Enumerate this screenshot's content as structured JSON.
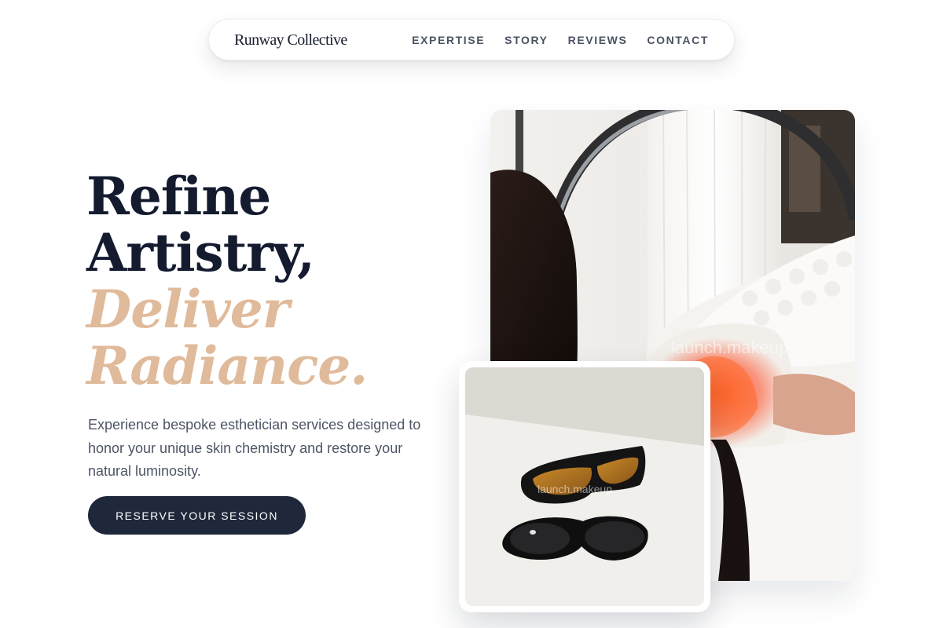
{
  "nav": {
    "brand": "Runway Collective",
    "links": [
      "EXPERTISE",
      "STORY",
      "REVIEWS",
      "CONTACT"
    ]
  },
  "hero": {
    "headline_lines": [
      "Refine",
      "Artistry,"
    ],
    "headline_accent_lines": [
      "Deliver",
      "Radiance."
    ],
    "subcopy": "Experience bespoke esthetician services designed to honor your unique skin chemistry and restore your natural luminosity.",
    "cta_label": "RESERVE YOUR SESSION"
  },
  "images": {
    "main_watermark": "launch.makeup",
    "small_watermark": "launch.makeup"
  },
  "colors": {
    "accent": "#e0bb9b",
    "heading": "#141b2f",
    "cta_bg": "#1f283b",
    "body_text": "#4d5566"
  }
}
